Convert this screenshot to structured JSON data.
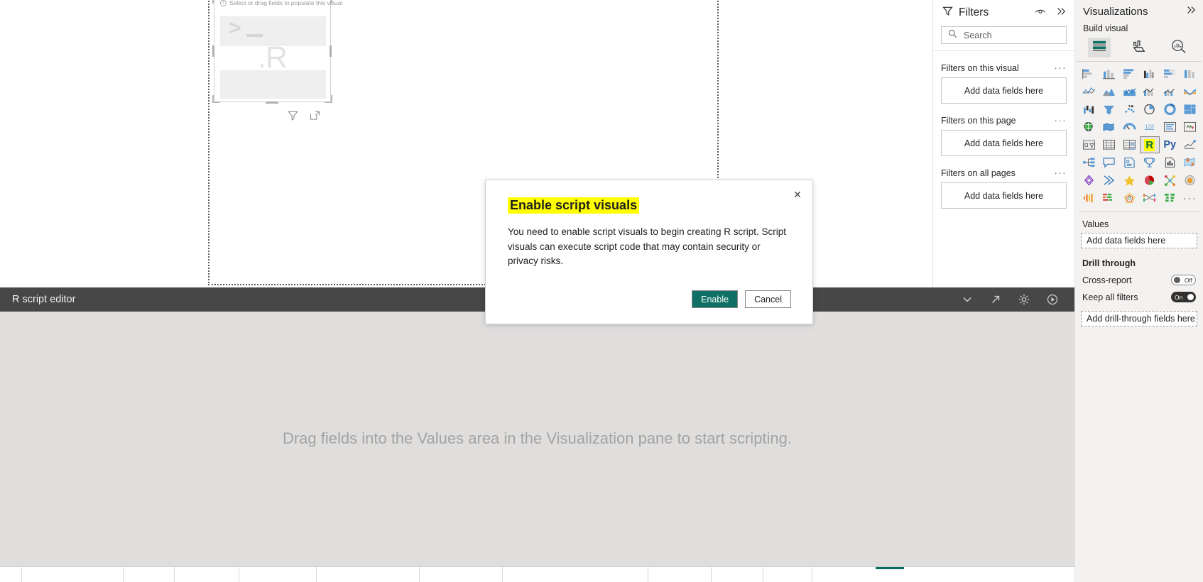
{
  "canvas": {
    "visual_hint": "Select or drag fields to populate this visual",
    "r_label": ".R",
    "prompt_glyph": ">",
    "filter_icon": "filter-icon",
    "focus_icon": "focus-mode-icon"
  },
  "editor": {
    "title": "R script editor",
    "placeholder": "Drag fields into the Values area in the Visualization pane to start scripting.",
    "icons": [
      "chevron-down-icon",
      "expand-arrow-icon",
      "gear-icon",
      "run-script-icon"
    ]
  },
  "filters": {
    "title": "Filters",
    "filter_icon": "funnel-icon",
    "eye_icon": "eye-icon",
    "collapse_icon": "double-chevron-right-icon",
    "search": {
      "placeholder": "Search",
      "icon": "search-icon",
      "value": ""
    },
    "groups": [
      {
        "label": "Filters on this visual",
        "drop_label": "Add data fields here",
        "menu": "···"
      },
      {
        "label": "Filters on this page",
        "drop_label": "Add data fields here",
        "menu": "···"
      },
      {
        "label": "Filters on all pages",
        "drop_label": "Add data fields here",
        "menu": "···"
      }
    ]
  },
  "visualizations": {
    "title": "Visualizations",
    "collapse_icon": "double-chevron-right-icon",
    "build_visual_label": "Build visual",
    "tabs": [
      {
        "name": "build-tab",
        "icon": "build-fields-icon",
        "active": true
      },
      {
        "name": "format-tab",
        "icon": "format-paintbrush-icon",
        "active": false
      },
      {
        "name": "analytics-tab",
        "icon": "analytics-magnifier-icon",
        "active": false
      }
    ],
    "visual_types": [
      {
        "name": "stacked-bar-chart",
        "selected": false
      },
      {
        "name": "stacked-column-chart",
        "selected": false
      },
      {
        "name": "clustered-bar-chart",
        "selected": false
      },
      {
        "name": "clustered-column-chart",
        "selected": false
      },
      {
        "name": "hundred-percent-stacked-bar-chart",
        "selected": false
      },
      {
        "name": "hundred-percent-stacked-column-chart",
        "selected": false
      },
      {
        "name": "line-chart",
        "selected": false
      },
      {
        "name": "area-chart",
        "selected": false
      },
      {
        "name": "stacked-area-chart",
        "selected": false
      },
      {
        "name": "line-and-stacked-column-chart",
        "selected": false
      },
      {
        "name": "line-and-clustered-column-chart",
        "selected": false
      },
      {
        "name": "ribbon-chart",
        "selected": false
      },
      {
        "name": "waterfall-chart",
        "selected": false
      },
      {
        "name": "funnel-chart",
        "selected": false
      },
      {
        "name": "scatter-chart",
        "selected": false
      },
      {
        "name": "pie-chart",
        "selected": false
      },
      {
        "name": "donut-chart",
        "selected": false
      },
      {
        "name": "treemap-chart",
        "selected": false
      },
      {
        "name": "map-visual",
        "selected": false
      },
      {
        "name": "filled-map-visual",
        "selected": false
      },
      {
        "name": "gauge-visual",
        "selected": false
      },
      {
        "name": "card-visual",
        "selected": false
      },
      {
        "name": "multi-row-card-visual",
        "selected": false
      },
      {
        "name": "kpi-visual",
        "selected": false
      },
      {
        "name": "slicer-visual",
        "selected": false
      },
      {
        "name": "table-visual",
        "selected": false
      },
      {
        "name": "matrix-visual",
        "selected": false
      },
      {
        "name": "r-script-visual",
        "selected": true,
        "glyph": "R"
      },
      {
        "name": "python-script-visual",
        "selected": false,
        "glyph": "Py"
      },
      {
        "name": "key-influencers-visual",
        "selected": false
      },
      {
        "name": "decomposition-tree-visual",
        "selected": false
      },
      {
        "name": "q-and-a-visual",
        "selected": false
      },
      {
        "name": "narrative-visual",
        "selected": false
      },
      {
        "name": "metrics-visual",
        "selected": false
      },
      {
        "name": "paginated-report-visual",
        "selected": false
      },
      {
        "name": "arcgis-map-visual",
        "selected": false
      },
      {
        "name": "power-apps-visual",
        "selected": false
      },
      {
        "name": "power-automate-visual",
        "selected": false
      },
      {
        "name": "star-favorite-visual",
        "selected": false
      },
      {
        "name": "sunburst-visual",
        "selected": false
      },
      {
        "name": "network-visual",
        "selected": false
      },
      {
        "name": "bubble-visual",
        "selected": false
      },
      {
        "name": "bullet-visual",
        "selected": false
      },
      {
        "name": "gantt-visual",
        "selected": false
      },
      {
        "name": "radar-visual",
        "selected": false
      },
      {
        "name": "sankey-visual",
        "selected": false
      },
      {
        "name": "tornado-visual",
        "selected": false
      },
      {
        "name": "more-visuals",
        "selected": false,
        "glyph": "···"
      }
    ],
    "values": {
      "label": "Values",
      "drop_label": "Add data fields here"
    },
    "drill_through": {
      "label": "Drill through",
      "cross_report": {
        "label": "Cross-report",
        "state": "Off",
        "on": false
      },
      "keep_all_filters": {
        "label": "Keep all filters",
        "state": "On",
        "on": true
      },
      "drop_label": "Add drill-through fields here"
    }
  },
  "dialog": {
    "title": "Enable script visuals",
    "body": "You need to enable script visuals to begin creating R script. Script visuals can execute script code that may contain security or privacy risks.",
    "primary_button": "Enable",
    "secondary_button": "Cancel",
    "close_icon": "close-icon",
    "highlight_color": "#ffff00",
    "accent_color": "#0f7165"
  }
}
